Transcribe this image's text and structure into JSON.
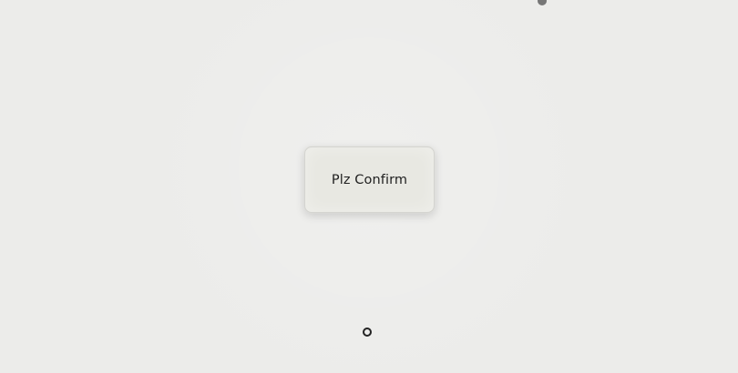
{
  "dialog": {
    "button_label": "Plz Confirm"
  },
  "indicators": {
    "top_dot_color": "#707070",
    "ring_color": "#222222"
  }
}
